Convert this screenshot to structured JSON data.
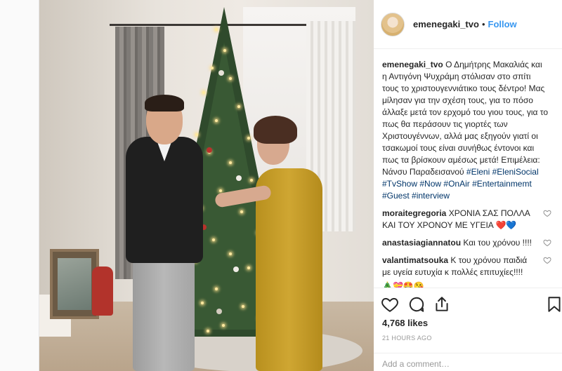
{
  "header": {
    "username": "emenegaki_tvo",
    "separator": "•",
    "follow_label": "Follow"
  },
  "caption": {
    "username": "emenegaki_tvo",
    "text": "Ο Δημήτρης Μακαλιάς και η Αντιγόνη Ψυχράμη στόλισαν στο σπίτι τους το χριστουγεννιάτικο τους δέντρο! Μας μίλησαν για την σχέση τους, για το πόσο άλλαξε μετά τον ερχομό του γιου τους, για το πως θα περάσουν τις γιορτές των Χριστουγέννων, αλλά μας εξηγούν γιατί οι τσακωμοί τους είναι συνήθως έντονοι και πως τα βρίσκουν αμέσως μετά! Επιμέλεια: Νάνσυ Παραδεισανού",
    "hashtags": [
      "#Eleni",
      "#EleniSocial",
      "#TvShow",
      "#Now",
      "#OnAir",
      "#Entertainmemt",
      "#Guest",
      "#interview"
    ]
  },
  "comments": [
    {
      "username": "moraitegregoria",
      "text": "ΧΡΟΝΙΑ ΣΑΣ ΠΟΛΛΑ ΚΑΙ ΤΟΥ ΧΡΟΝΟΥ ΜΕ ΥΓΕΙΑ",
      "emoji": "❤️💙"
    },
    {
      "username": "anastasiagiannatou",
      "text": "Και του χρόνου !!!!",
      "emoji": ""
    },
    {
      "username": "valantimatsouka",
      "text": "Κ του χρόνου παιδιά με υγεία ευτυχία κ πολλές επιτυχίες!!!!",
      "emoji": "🎄💝🤩😘"
    }
  ],
  "stats": {
    "likes": "4,768 likes",
    "time": "21 HOURS AGO"
  },
  "add_comment": {
    "placeholder": "Add a comment…"
  },
  "colors": {
    "link": "#3897f0",
    "hashtag": "#003569",
    "muted": "#999999"
  },
  "icons": [
    "heart-icon",
    "comment-icon",
    "share-icon",
    "bookmark-icon"
  ]
}
